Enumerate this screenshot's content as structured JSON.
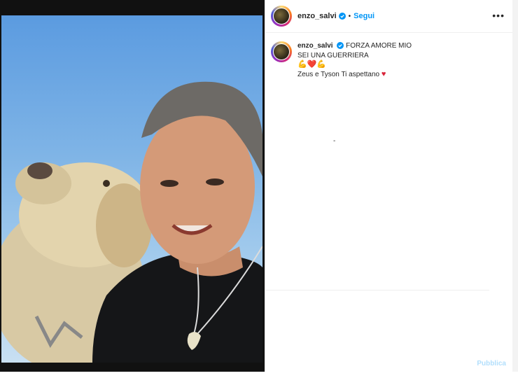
{
  "post": {
    "username": "enzo_salvi",
    "follow_label": "Segui",
    "separator": "•",
    "more_label": "•••"
  },
  "caption": {
    "username": "enzo_salvi",
    "line1": "FORZA AMORE MIO",
    "line2": "SEI UNA GUERRIERA",
    "emoji_line": "💪❤️💪",
    "line3": "Zeus e Tyson Ti aspettano"
  },
  "footer": {
    "publish_label": "Pubblica"
  },
  "colors": {
    "accent": "#0095f6",
    "heart": "#d8243a"
  }
}
